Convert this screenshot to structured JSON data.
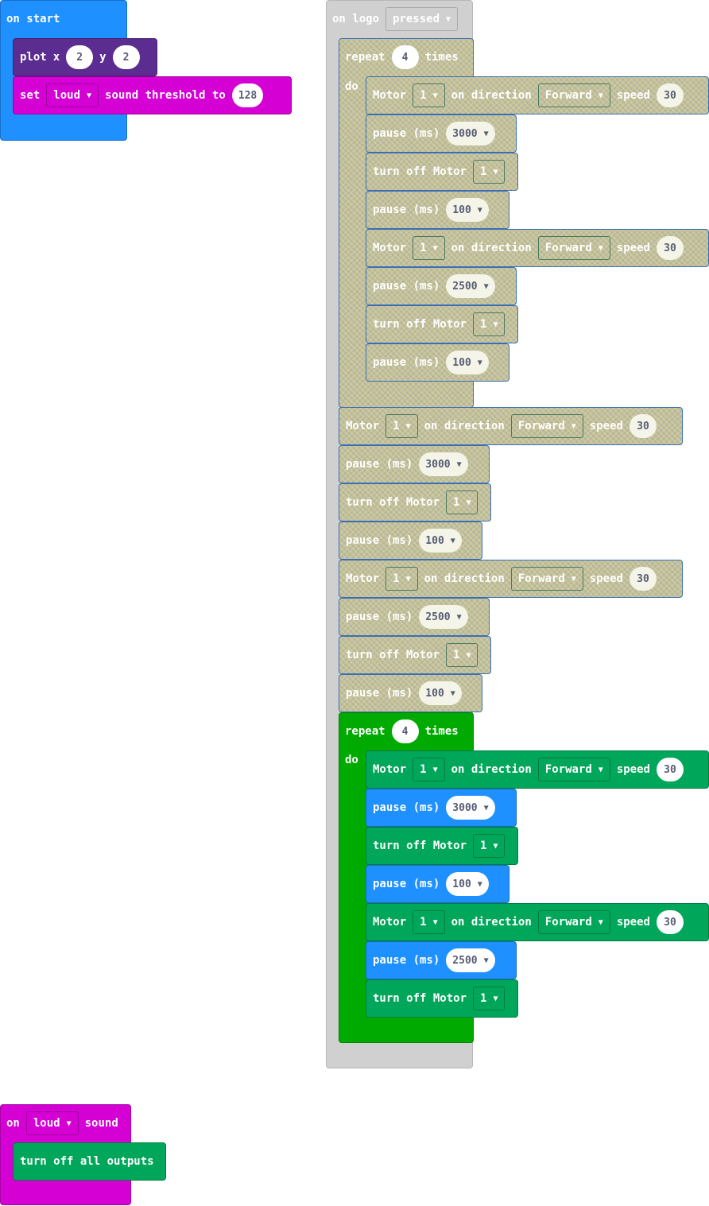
{
  "on_start": {
    "hat_label": "on start",
    "plot": {
      "label": "plot",
      "x_label": "x",
      "x_value": "2",
      "y_label": "y",
      "y_value": "2"
    },
    "set_threshold": {
      "set_label": "set",
      "mode": "loud",
      "text": "sound threshold to",
      "value": "128"
    }
  },
  "on_logo": {
    "hat_label": "on logo",
    "event": "pressed",
    "disabled_repeat": {
      "repeat_label": "repeat",
      "times_value": "4",
      "times_label": "times",
      "do_label": "do",
      "motor_label": "Motor",
      "on_direction_label": "on direction",
      "speed_label": "speed",
      "pause_label": "pause (ms)",
      "turn_off_label": "turn off Motor",
      "motor1": {
        "motor": "1",
        "direction": "Forward",
        "speed": "30"
      },
      "pause1": "3000",
      "off1": "1",
      "pause2": "100",
      "motor2": {
        "motor": "1",
        "direction": "Forward",
        "speed": "30"
      },
      "pause3": "2500",
      "off2": "1",
      "pause4": "100"
    },
    "disabled_seq": {
      "motor_label": "Motor",
      "on_direction_label": "on direction",
      "speed_label": "speed",
      "pause_label": "pause (ms)",
      "turn_off_label": "turn off Motor",
      "motor1": {
        "motor": "1",
        "direction": "Forward",
        "speed": "30"
      },
      "pause1": "3000",
      "off1": "1",
      "pause2": "100",
      "motor2": {
        "motor": "1",
        "direction": "Forward",
        "speed": "30"
      },
      "pause3": "2500",
      "off2": "1",
      "pause4": "100"
    },
    "active_repeat": {
      "repeat_label": "repeat",
      "times_value": "4",
      "times_label": "times",
      "do_label": "do",
      "motor_label": "Motor",
      "on_direction_label": "on direction",
      "speed_label": "speed",
      "pause_label": "pause (ms)",
      "turn_off_label": "turn off Motor",
      "motor1": {
        "motor": "1",
        "direction": "Forward",
        "speed": "30"
      },
      "pause1": "3000",
      "off1": "1",
      "pause2": "100",
      "motor2": {
        "motor": "1",
        "direction": "Forward",
        "speed": "30"
      },
      "pause3": "2500",
      "off2": "1"
    }
  },
  "on_sound": {
    "on_label": "on",
    "mode": "loud",
    "sound_label": "sound",
    "action": "turn off all outputs"
  },
  "colors": {
    "basic": "#1e90ff",
    "led": "#5c2d91",
    "input": "#d400d4",
    "loops": "#00aa00",
    "motor": "#00a65a",
    "disabled_frame": "#d0d0d0",
    "disabled_fill": "#c4c090"
  },
  "icons": {
    "dropdown": "caret-down-icon"
  }
}
